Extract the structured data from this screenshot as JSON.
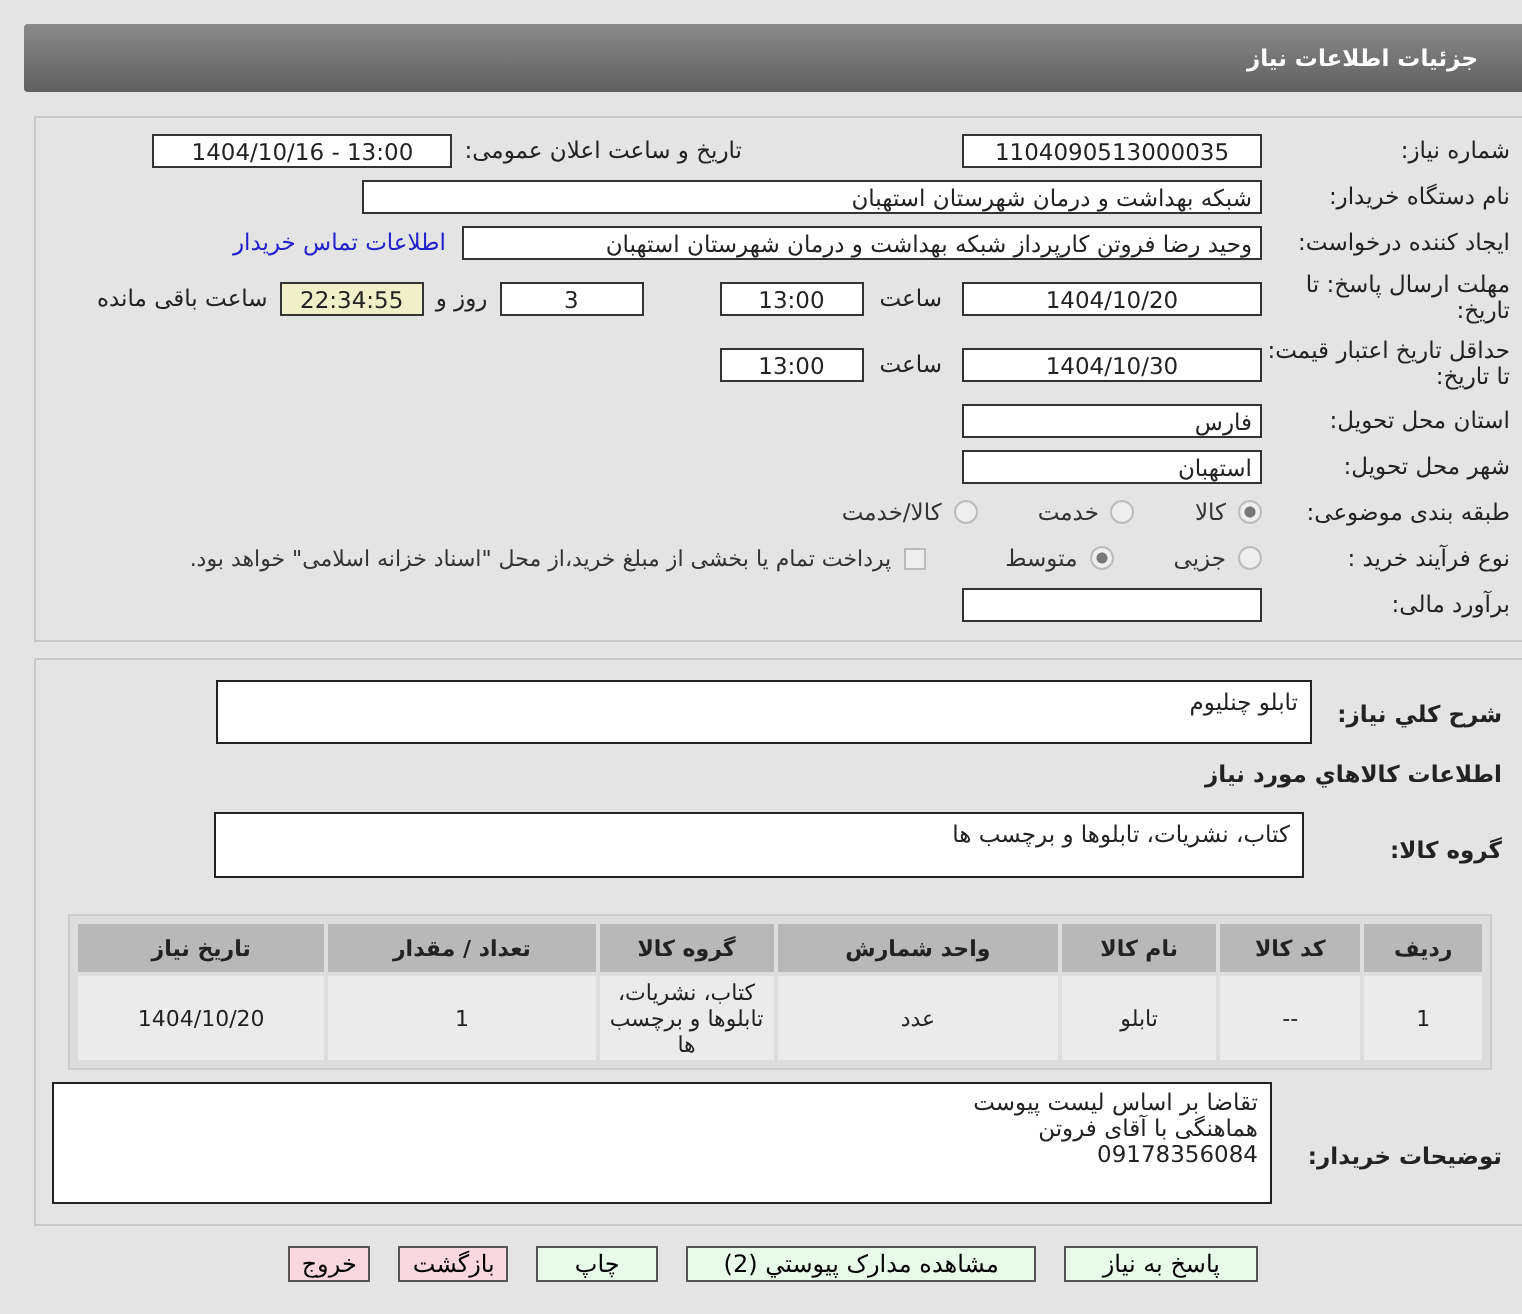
{
  "header": {
    "title": "جزئیات اطلاعات نیاز"
  },
  "fields": {
    "need_number": {
      "label": "شماره نیاز:",
      "value": "1104090513000035"
    },
    "announce": {
      "label": "تاریخ و ساعت اعلان عمومی:",
      "value": "1404/10/16 - 13:00"
    },
    "buyer": {
      "label": "نام دستگاه خریدار:",
      "value": "شبکه بهداشت و درمان شهرستان استهبان"
    },
    "creator": {
      "label": "ایجاد کننده درخواست:",
      "value": "وحید رضا فروتن کارپرداز شبکه بهداشت و درمان شهرستان استهبان",
      "link": "اطلاعات تماس خریدار"
    },
    "deadline": {
      "label": "مهلت ارسال پاسخ: تا تاریخ:",
      "date": "1404/10/20",
      "time_label": "ساعت",
      "time": "13:00",
      "days": "3",
      "days_label": "روز و",
      "remaining": "22:34:55",
      "remaining_label": "ساعت باقی مانده"
    },
    "validity": {
      "label": "حداقل تاریخ اعتبار قیمت: تا تاریخ:",
      "date": "1404/10/30",
      "time_label": "ساعت",
      "time": "13:00"
    },
    "province": {
      "label": "استان محل تحویل:",
      "value": "فارس"
    },
    "city": {
      "label": "شهر محل تحویل:",
      "value": "استهبان"
    },
    "category": {
      "label": "طبقه بندی موضوعی:",
      "options": [
        {
          "label": "کالا",
          "selected": true
        },
        {
          "label": "خدمت",
          "selected": false
        },
        {
          "label": "کالا/خدمت",
          "selected": false
        }
      ]
    },
    "process": {
      "label": "نوع فرآیند خرید :",
      "options": [
        {
          "label": "جزیی",
          "selected": false
        },
        {
          "label": "متوسط",
          "selected": true
        }
      ],
      "treasury": {
        "label": "پرداخت تمام یا بخشی از مبلغ خرید،از محل \"اسناد خزانه اسلامی\" خواهد بود.",
        "checked": false
      }
    },
    "estimate": {
      "label": "برآورد مالی:"
    }
  },
  "details": {
    "description": {
      "label": "شرح کلي نياز:",
      "value": "تابلو چنلیوم"
    },
    "goods_heading": "اطلاعات کالاهاي مورد نياز",
    "group": {
      "label": "گروه کالا:",
      "value": "کتاب، نشریات، تابلوها و برچسب ها"
    },
    "table": {
      "columns": [
        "ردیف",
        "کد کالا",
        "نام کالا",
        "واحد شمارش",
        "گروه کالا",
        "تعداد / مقدار",
        "تاریخ نیاز"
      ],
      "rows": [
        [
          "1",
          "--",
          "تابلو",
          "عدد",
          "کتاب، نشریات، تابلوها و برچسب ها",
          "1",
          "1404/10/20"
        ]
      ]
    },
    "notes": {
      "label": "توضیحات خریدار:",
      "lines": [
        "تقاضا بر اساس لیست پیوست",
        "هماهنگی با آقای فروتن",
        "09178356084"
      ]
    }
  },
  "buttons": [
    {
      "label": "پاسخ به نیاز",
      "kind": "green"
    },
    {
      "label": "مشاهده مدارک پیوستي (2)",
      "kind": "green"
    },
    {
      "label": "چاپ",
      "kind": "green"
    },
    {
      "label": "بازگشت",
      "kind": "red"
    },
    {
      "label": "خروج",
      "kind": "red"
    }
  ]
}
